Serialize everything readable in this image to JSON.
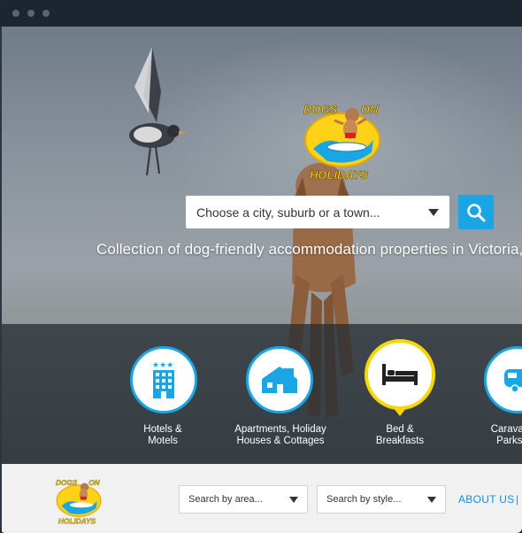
{
  "window": {
    "controls": [
      "close",
      "minimize",
      "maximize"
    ]
  },
  "hero": {
    "logo": {
      "line1": "DOGS ON",
      "line2": "HOLIDAYS"
    },
    "search": {
      "select_placeholder": "Choose a city, suburb or a town...",
      "search_button_icon": "search-icon"
    },
    "tagline": "Collection of dog-friendly accommodation properties in Victoria,"
  },
  "categories": [
    {
      "label_line1": "Hotels &",
      "label_line2": "Motels",
      "icon": "hotel-icon",
      "selected": false
    },
    {
      "label_line1": "Apartments, Holiday",
      "label_line2": "Houses & Cottages",
      "icon": "house-icon",
      "selected": false
    },
    {
      "label_line1": "Bed &",
      "label_line2": "Breakfasts",
      "icon": "bed-icon",
      "selected": true
    },
    {
      "label_line1": "Caravan Par",
      "label_line2": "Parks & C",
      "icon": "caravan-icon",
      "selected": false
    }
  ],
  "footer": {
    "area_select": "Search by area...",
    "style_select": "Search by style...",
    "about_link": "ABOUT US",
    "separator": "|"
  },
  "colors": {
    "accent_blue": "#1aa6e4",
    "highlight_yellow": "#f5d800",
    "logo_yellow": "#ffd21a"
  }
}
